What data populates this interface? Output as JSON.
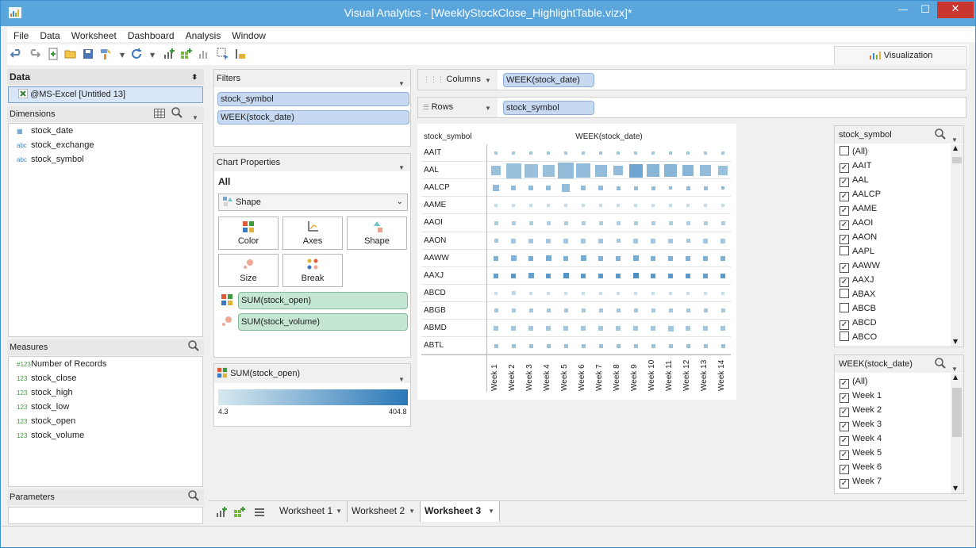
{
  "window": {
    "title": "Visual Analytics - [WeeklyStockClose_HighlightTable.vizx]*",
    "minimize": "—",
    "maximize": "☐",
    "close": "✕"
  },
  "menu": [
    "File",
    "Data",
    "Worksheet",
    "Dashboard",
    "Analysis",
    "Window"
  ],
  "toolbar_icons": [
    "undo-icon",
    "redo-icon",
    "new-icon",
    "open-icon",
    "save-icon",
    "paint-icon",
    "refresh-icon",
    "add-chart-icon",
    "add-grid-icon",
    "bar-chart-icon",
    "select-icon",
    "sort-icon"
  ],
  "viz_tab": "Visualization",
  "data_panel": {
    "header": "Data",
    "source": "@MS-Excel [Untitled 13]",
    "dimensions_header": "Dimensions",
    "dimensions": [
      {
        "icon": "date-icon",
        "label": "stock_date"
      },
      {
        "icon": "abc",
        "label": "stock_exchange"
      },
      {
        "icon": "abc",
        "label": "stock_symbol"
      }
    ],
    "measures_header": "Measures",
    "measures": [
      {
        "icon": "#123",
        "label": "Number of Records"
      },
      {
        "icon": "123",
        "label": "stock_close"
      },
      {
        "icon": "123",
        "label": "stock_high"
      },
      {
        "icon": "123",
        "label": "stock_low"
      },
      {
        "icon": "123",
        "label": "stock_open"
      },
      {
        "icon": "123",
        "label": "stock_volume"
      }
    ],
    "parameters_header": "Parameters"
  },
  "filters": {
    "header": "Filters",
    "pills": [
      "stock_symbol",
      "WEEK(stock_date)"
    ]
  },
  "chart_properties": {
    "header": "Chart Properties",
    "scope": "All",
    "mark_type": "Shape",
    "buttons": [
      "Color",
      "Axes",
      "Shape",
      "Size",
      "Break"
    ],
    "encodings": [
      {
        "icon": "color-icon",
        "field": "SUM(stock_open)"
      },
      {
        "icon": "size-icon",
        "field": "SUM(stock_volume)"
      }
    ]
  },
  "legend": {
    "field": "SUM(stock_open)",
    "min": "4.3",
    "max": "404.8",
    "color_low": "#d7e9f0",
    "color_high": "#2a78b8"
  },
  "shelves": {
    "columns_label": "Columns",
    "columns_pill": "WEEK(stock_date)",
    "rows_label": "Rows",
    "rows_pill": "stock_symbol"
  },
  "chart_data": {
    "type": "table",
    "row_header": "stock_symbol",
    "col_header": "WEEK(stock_date)",
    "rows": [
      "AAIT",
      "AAL",
      "AALCP",
      "AAME",
      "AAOI",
      "AAON",
      "AAWW",
      "AAXJ",
      "ABCD",
      "ABGB",
      "ABMD",
      "ABTL"
    ],
    "columns": [
      "Week 1",
      "Week 2",
      "Week 3",
      "Week 4",
      "Week 5",
      "Week 6",
      "Week 7",
      "Week 8",
      "Week 9",
      "Week 10",
      "Week 11",
      "Week 12",
      "Week 13",
      "Week 14"
    ],
    "marks": "square size = SUM(stock_volume), color = SUM(stock_open)",
    "size": [
      [
        0.2,
        0.2,
        0.2,
        0.2,
        0.2,
        0.2,
        0.2,
        0.2,
        0.2,
        0.2,
        0.2,
        0.2,
        0.2,
        0.2
      ],
      [
        0.6,
        0.95,
        0.85,
        0.75,
        1.0,
        0.9,
        0.75,
        0.6,
        0.85,
        0.8,
        0.8,
        0.7,
        0.7,
        0.6
      ],
      [
        0.4,
        0.3,
        0.3,
        0.3,
        0.5,
        0.3,
        0.3,
        0.25,
        0.25,
        0.25,
        0.2,
        0.25,
        0.25,
        0.2
      ],
      [
        0.2,
        0.2,
        0.2,
        0.2,
        0.2,
        0.2,
        0.2,
        0.2,
        0.2,
        0.2,
        0.2,
        0.2,
        0.2,
        0.2
      ],
      [
        0.25,
        0.25,
        0.25,
        0.25,
        0.25,
        0.25,
        0.25,
        0.25,
        0.25,
        0.25,
        0.25,
        0.25,
        0.25,
        0.25
      ],
      [
        0.25,
        0.3,
        0.3,
        0.3,
        0.3,
        0.3,
        0.3,
        0.25,
        0.3,
        0.3,
        0.3,
        0.25,
        0.3,
        0.3
      ],
      [
        0.3,
        0.35,
        0.3,
        0.35,
        0.3,
        0.35,
        0.3,
        0.3,
        0.35,
        0.3,
        0.3,
        0.3,
        0.3,
        0.3
      ],
      [
        0.3,
        0.3,
        0.35,
        0.3,
        0.35,
        0.3,
        0.3,
        0.3,
        0.35,
        0.3,
        0.3,
        0.3,
        0.3,
        0.3
      ],
      [
        0.2,
        0.25,
        0.2,
        0.2,
        0.2,
        0.2,
        0.2,
        0.2,
        0.2,
        0.2,
        0.2,
        0.2,
        0.2,
        0.2
      ],
      [
        0.25,
        0.25,
        0.25,
        0.25,
        0.25,
        0.25,
        0.25,
        0.25,
        0.25,
        0.25,
        0.25,
        0.25,
        0.25,
        0.25
      ],
      [
        0.3,
        0.3,
        0.3,
        0.3,
        0.3,
        0.3,
        0.3,
        0.3,
        0.3,
        0.3,
        0.35,
        0.3,
        0.3,
        0.3
      ],
      [
        0.25,
        0.25,
        0.25,
        0.25,
        0.25,
        0.25,
        0.25,
        0.25,
        0.25,
        0.25,
        0.25,
        0.25,
        0.25,
        0.25
      ]
    ],
    "color": [
      [
        0.3,
        0.3,
        0.3,
        0.3,
        0.3,
        0.3,
        0.3,
        0.3,
        0.3,
        0.3,
        0.3,
        0.3,
        0.3,
        0.3
      ],
      [
        0.35,
        0.35,
        0.35,
        0.35,
        0.4,
        0.4,
        0.4,
        0.4,
        0.6,
        0.45,
        0.45,
        0.45,
        0.4,
        0.35
      ],
      [
        0.4,
        0.4,
        0.4,
        0.4,
        0.4,
        0.4,
        0.4,
        0.4,
        0.4,
        0.4,
        0.4,
        0.4,
        0.4,
        0.4
      ],
      [
        0.1,
        0.1,
        0.1,
        0.1,
        0.1,
        0.1,
        0.1,
        0.1,
        0.1,
        0.1,
        0.1,
        0.1,
        0.1,
        0.1
      ],
      [
        0.25,
        0.25,
        0.25,
        0.25,
        0.25,
        0.25,
        0.25,
        0.25,
        0.25,
        0.25,
        0.25,
        0.25,
        0.25,
        0.25
      ],
      [
        0.3,
        0.3,
        0.3,
        0.3,
        0.3,
        0.3,
        0.3,
        0.3,
        0.3,
        0.3,
        0.3,
        0.3,
        0.3,
        0.3
      ],
      [
        0.5,
        0.5,
        0.55,
        0.55,
        0.5,
        0.55,
        0.5,
        0.5,
        0.55,
        0.5,
        0.5,
        0.5,
        0.5,
        0.5
      ],
      [
        0.65,
        0.7,
        0.65,
        0.7,
        0.75,
        0.7,
        0.7,
        0.7,
        0.8,
        0.7,
        0.7,
        0.7,
        0.65,
        0.7
      ],
      [
        0.1,
        0.15,
        0.1,
        0.1,
        0.1,
        0.1,
        0.1,
        0.1,
        0.1,
        0.1,
        0.1,
        0.1,
        0.1,
        0.1
      ],
      [
        0.3,
        0.3,
        0.3,
        0.3,
        0.3,
        0.3,
        0.3,
        0.3,
        0.3,
        0.3,
        0.3,
        0.3,
        0.3,
        0.3
      ],
      [
        0.3,
        0.3,
        0.3,
        0.3,
        0.3,
        0.3,
        0.3,
        0.3,
        0.3,
        0.3,
        0.3,
        0.3,
        0.3,
        0.3
      ],
      [
        0.35,
        0.35,
        0.35,
        0.35,
        0.35,
        0.35,
        0.35,
        0.35,
        0.35,
        0.35,
        0.35,
        0.35,
        0.35,
        0.35
      ]
    ]
  },
  "symbol_filter": {
    "header": "stock_symbol",
    "items": [
      {
        "label": "(All)",
        "checked": false
      },
      {
        "label": "AAIT",
        "checked": true
      },
      {
        "label": "AAL",
        "checked": true
      },
      {
        "label": "AALCP",
        "checked": true
      },
      {
        "label": "AAME",
        "checked": true
      },
      {
        "label": "AAOI",
        "checked": true
      },
      {
        "label": "AAON",
        "checked": true
      },
      {
        "label": "AAPL",
        "checked": false
      },
      {
        "label": "AAWW",
        "checked": true
      },
      {
        "label": "AAXJ",
        "checked": true
      },
      {
        "label": "ABAX",
        "checked": false
      },
      {
        "label": "ABCB",
        "checked": false
      },
      {
        "label": "ABCD",
        "checked": true
      },
      {
        "label": "ABCO",
        "checked": false
      }
    ]
  },
  "week_filter": {
    "header": "WEEK(stock_date)",
    "items": [
      {
        "label": "(All)",
        "checked": true
      },
      {
        "label": "Week 1",
        "checked": true
      },
      {
        "label": "Week 2",
        "checked": true
      },
      {
        "label": "Week 3",
        "checked": true
      },
      {
        "label": "Week 4",
        "checked": true
      },
      {
        "label": "Week 5",
        "checked": true
      },
      {
        "label": "Week 6",
        "checked": true
      },
      {
        "label": "Week 7",
        "checked": true
      }
    ]
  },
  "sheet_tabs": [
    {
      "label": "Worksheet 1",
      "active": false
    },
    {
      "label": "Worksheet 2",
      "active": false
    },
    {
      "label": "Worksheet 3",
      "active": true
    }
  ]
}
